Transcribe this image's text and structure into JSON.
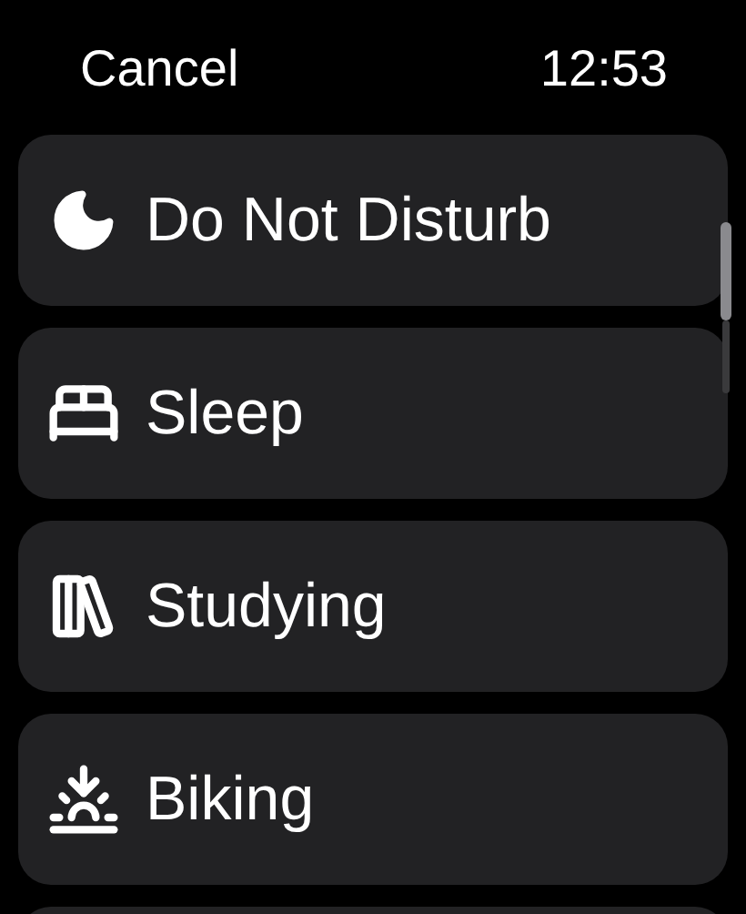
{
  "header": {
    "cancel": "Cancel",
    "time": "12:53"
  },
  "focus_modes": [
    {
      "label": "Do Not Disturb"
    },
    {
      "label": "Sleep"
    },
    {
      "label": "Studying"
    },
    {
      "label": "Biking"
    }
  ]
}
